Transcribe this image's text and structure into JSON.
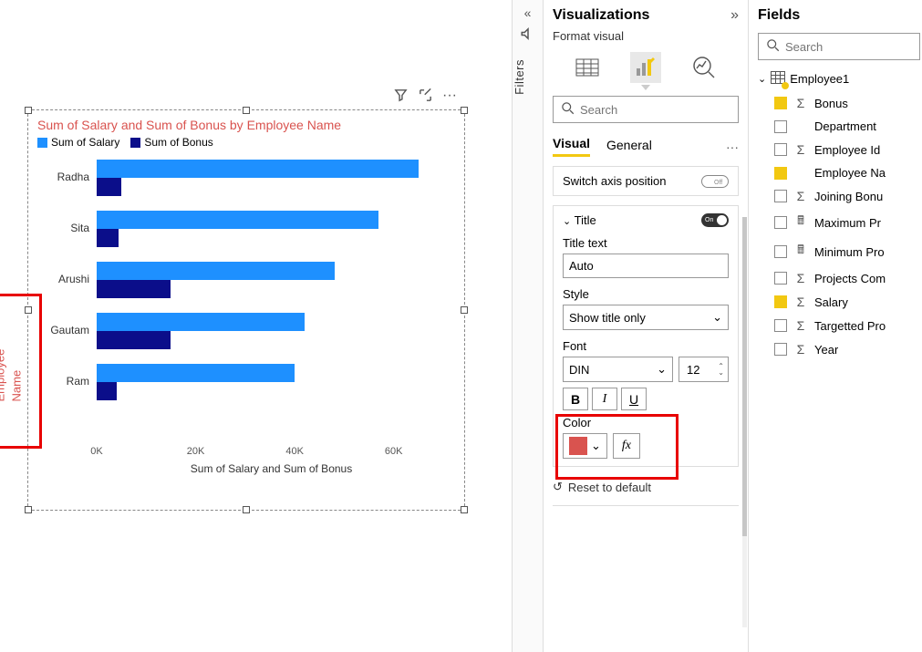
{
  "chart_data": {
    "type": "bar",
    "orientation": "horizontal",
    "title": "Sum of Salary and Sum of Bonus by Employee Name",
    "ylabel": "Employee Name",
    "xlabel": "Sum of Salary and Sum of Bonus",
    "categories": [
      "Radha",
      "Sita",
      "Arushi",
      "Gautam",
      "Ram"
    ],
    "series": [
      {
        "name": "Sum of Salary",
        "color": "#1e90ff",
        "values": [
          65000,
          57000,
          48000,
          42000,
          40000
        ]
      },
      {
        "name": "Sum of Bonus",
        "color": "#0b0e8a",
        "values": [
          5000,
          4500,
          15000,
          15000,
          4000
        ]
      }
    ],
    "x_ticks": [
      "0K",
      "20K",
      "40K",
      "60K"
    ],
    "xlim": [
      0,
      70000
    ]
  },
  "filters": {
    "label": "Filters"
  },
  "viz": {
    "title": "Visualizations",
    "subtitle": "Format visual",
    "search_placeholder": "Search",
    "tabs": {
      "visual": "Visual",
      "general": "General"
    },
    "switch_axis": "Switch axis position",
    "switch_axis_state": "Off",
    "title_section": {
      "label": "Title",
      "state": "On",
      "title_text_label": "Title text",
      "title_text_value": "Auto",
      "style_label": "Style",
      "style_value": "Show title only",
      "font_label": "Font",
      "font_family": "DIN",
      "font_size": "12",
      "color_label": "Color",
      "color_value": "#d9534f",
      "fx": "fx"
    },
    "reset": "Reset to default"
  },
  "fields": {
    "title": "Fields",
    "search_placeholder": "Search",
    "table": "Employee1",
    "items": [
      {
        "name": "Bonus",
        "checked": true,
        "icon": "sigma"
      },
      {
        "name": "Department",
        "checked": false,
        "icon": "none"
      },
      {
        "name": "Employee Id",
        "checked": false,
        "icon": "sigma"
      },
      {
        "name": "Employee Na",
        "checked": true,
        "icon": "none"
      },
      {
        "name": "Joining Bonu",
        "checked": false,
        "icon": "sigma"
      },
      {
        "name": "Maximum Pr",
        "checked": false,
        "icon": "calc"
      },
      {
        "name": "Minimum Pro",
        "checked": false,
        "icon": "calc"
      },
      {
        "name": "Projects Com",
        "checked": false,
        "icon": "sigma"
      },
      {
        "name": "Salary",
        "checked": true,
        "icon": "sigma"
      },
      {
        "name": "Targetted Pro",
        "checked": false,
        "icon": "sigma"
      },
      {
        "name": "Year",
        "checked": false,
        "icon": "sigma"
      }
    ]
  }
}
